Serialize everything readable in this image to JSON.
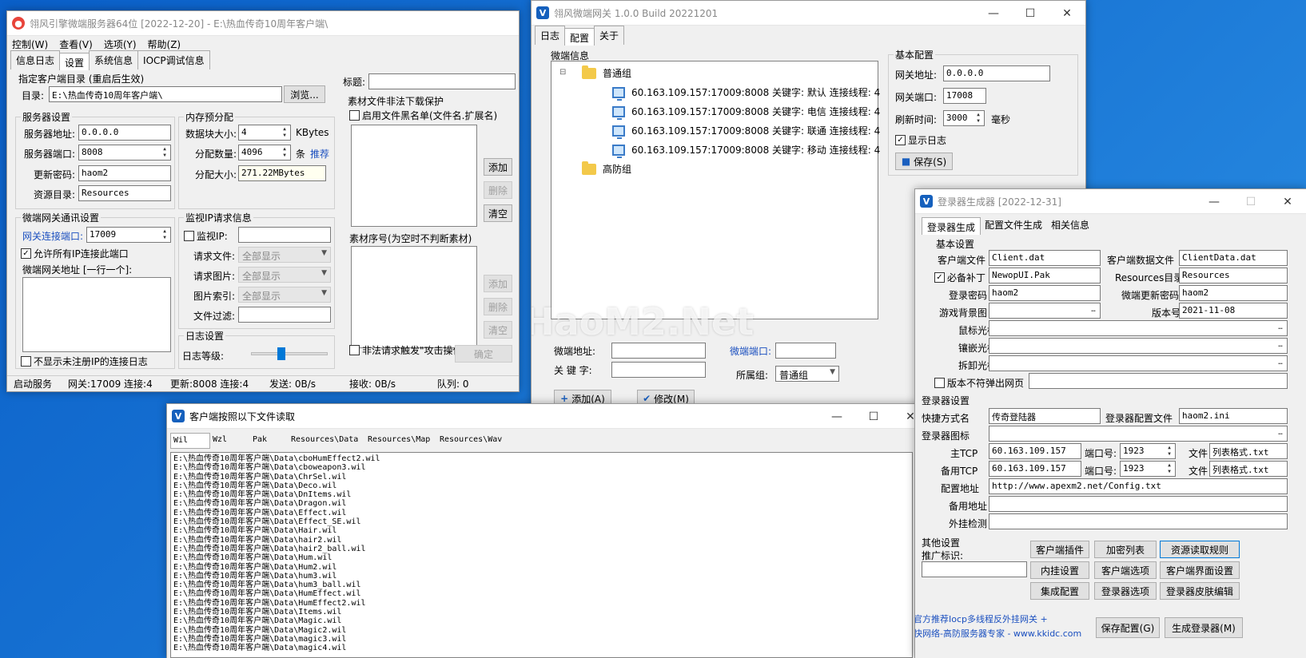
{
  "colors": {
    "accent": "#0078d7",
    "link": "#1a4fbf",
    "desktop": "#1b78d6",
    "gen_title_icon": "#1560bd"
  },
  "w1": {
    "title": "翎风引擎微端服务器64位 [2022-12-20] - E:\\热血传奇10周年客户端\\",
    "menu": [
      "控制(W)",
      "查看(V)",
      "选项(Y)",
      "帮助(Z)"
    ],
    "tabs": [
      "信息日志",
      "设置",
      "系统信息",
      "IOCP调试信息"
    ],
    "client_dir": {
      "title": "指定客户端目录 (重启后生效)",
      "label": "目录:",
      "value": "E:\\热血传奇10周年客户端\\",
      "browse": "浏览..."
    },
    "server": {
      "title": "服务器设置",
      "addr_label": "服务器地址:",
      "addr": "0.0.0.0",
      "port_label": "服务器端口:",
      "port": "8008",
      "pwd_label": "更新密码:",
      "pwd": "haom2",
      "res_label": "资源目录:",
      "res": "Resources"
    },
    "mem": {
      "title": "内存预分配",
      "block_label": "数据块大小:",
      "block": "4",
      "block_unit": "KBytes",
      "count_label": "分配数量:",
      "count": "4096",
      "count_unit": "条",
      "recommend": "推荐",
      "size_label": "分配大小:",
      "size": "271.22MBytes"
    },
    "gw": {
      "title": "微端网关通讯设置",
      "port_label": "网关连接端口:",
      "port": "17009",
      "allow": "允许所有IP连接此端口",
      "addr_label": "微端网关地址 [一行一个]:",
      "no_log": "不显示未注册IP的连接日志"
    },
    "monitor": {
      "title": "监视IP请求信息",
      "ip": "监视IP:",
      "req_file": "请求文件:",
      "req_img": "请求图片:",
      "img_idx": "图片索引:",
      "file_filter": "文件过滤:",
      "opt": "全部显示"
    },
    "log": {
      "title": "日志设置",
      "level_label": "日志等级:",
      "level": 0.4
    },
    "material": {
      "title_label": "标题:",
      "protect": "素材文件非法下载保护",
      "blacklist": "启用文件黑名单(文件名.扩展名)",
      "add": "添加",
      "del": "删除",
      "clear": "清空",
      "seq": "素材序号(为空时不判断素材)",
      "attack": "非法请求触发\"攻击操作\"",
      "ok": "确定"
    },
    "status": [
      "启动服务",
      "网关:17009  连接:4",
      "更新:8008  连接:4",
      "发送: 0B/s",
      "接收: 0B/s",
      "队列: 0"
    ]
  },
  "w2": {
    "title": "翎风微端网关 1.0.0 Build 20221201",
    "tabs": [
      "日志",
      "配置",
      "关于"
    ],
    "info_title": "微端信息",
    "group1": "普通组",
    "nodes": [
      "60.163.109.157:17009:8008 关键字: 默认 连接线程: 4",
      "60.163.109.157:17009:8008 关键字: 电信 连接线程: 4",
      "60.163.109.157:17009:8008 关键字: 联通 连接线程: 4",
      "60.163.109.157:17009:8008 关键字: 移动 连接线程: 4"
    ],
    "group2": "高防组",
    "micro_addr": "微端地址:",
    "micro_port": "微端端口:",
    "keyword": "关 键 字:",
    "group_label": "所属组:",
    "group_val": "普通组",
    "add": "添加(A)",
    "modify": "修改(M)",
    "basic": {
      "title": "基本配置",
      "addr_label": "网关地址:",
      "addr": "0.0.0.0",
      "port_label": "网关端口:",
      "port": "17008",
      "refresh_label": "刷新时间:",
      "refresh": "3000",
      "ms": "毫秒",
      "showlog": "显示日志",
      "save": "保存(S)"
    },
    "watermark": "HaoM2.Net"
  },
  "w3": {
    "title": "客户端按照以下文件读取",
    "cols": [
      "Wil",
      "Wzl",
      "Pak",
      "Resources\\Data",
      "Resources\\Map",
      "Resources\\Wav"
    ],
    "files": [
      "E:\\热血传奇10周年客户端\\Data\\cboHumEffect2.wil",
      "E:\\热血传奇10周年客户端\\Data\\cboweapon3.wil",
      "E:\\热血传奇10周年客户端\\Data\\ChrSel.wil",
      "E:\\热血传奇10周年客户端\\Data\\Deco.wil",
      "E:\\热血传奇10周年客户端\\Data\\DnItems.wil",
      "E:\\热血传奇10周年客户端\\Data\\Dragon.wil",
      "E:\\热血传奇10周年客户端\\Data\\Effect.wil",
      "E:\\热血传奇10周年客户端\\Data\\Effect_SE.wil",
      "E:\\热血传奇10周年客户端\\Data\\Hair.wil",
      "E:\\热血传奇10周年客户端\\Data\\hair2.wil",
      "E:\\热血传奇10周年客户端\\Data\\hair2_ball.wil",
      "E:\\热血传奇10周年客户端\\Data\\Hum.wil",
      "E:\\热血传奇10周年客户端\\Data\\Hum2.wil",
      "E:\\热血传奇10周年客户端\\Data\\hum3.wil",
      "E:\\热血传奇10周年客户端\\Data\\hum3_ball.wil",
      "E:\\热血传奇10周年客户端\\Data\\HumEffect.wil",
      "E:\\热血传奇10周年客户端\\Data\\HumEffect2.wil",
      "E:\\热血传奇10周年客户端\\Data\\Items.wil",
      "E:\\热血传奇10周年客户端\\Data\\Magic.wil",
      "E:\\热血传奇10周年客户端\\Data\\Magic2.wil",
      "E:\\热血传奇10周年客户端\\Data\\magic3.wil",
      "E:\\热血传奇10周年客户端\\Data\\magic4.wil"
    ]
  },
  "w4": {
    "title": "登录器生成器 [2022-12-31]",
    "tabs": [
      "登录器生成",
      "配置文件生成",
      "相关信息"
    ],
    "basic_title": "基本设置",
    "client_file_label": "客户端文件",
    "client_file": "Client.dat",
    "client_data_label": "客户端数据文件",
    "client_data": "ClientData.dat",
    "patch_label": "必备补丁",
    "patch": "NewopUI.Pak",
    "res_dir_label": "Resources目录",
    "res_dir": "Resources",
    "login_pwd_label": "登录密码",
    "login_pwd": "haom2",
    "micro_pwd_label": "微端更新密码",
    "micro_pwd": "haom2",
    "bg_label": "游戏背景图",
    "ver_label": "版本号",
    "ver": "2021-11-08",
    "cursor_label": "鼠标光标",
    "inlay_label": "镶嵌光标",
    "remove_label": "拆卸光标",
    "popup": "版本不符弹出网页",
    "login_title": "登录器设置",
    "shortcut_label": "快捷方式名",
    "shortcut": "传奇登陆器",
    "cfg_label": "登录器配置文件",
    "cfg": "haom2.ini",
    "icon_label": "登录器图标",
    "main_tcp_label": "主TCP",
    "main_tcp": "60.163.109.157",
    "port_label": "端口号:",
    "main_port": "1923",
    "file_label": "文件",
    "main_file": "列表格式.txt",
    "bak_tcp_label": "备用TCP",
    "bak_tcp": "60.163.109.157",
    "bak_port": "1923",
    "bak_file": "列表格式.txt",
    "cfg_addr_label": "配置地址",
    "cfg_addr": "http://www.apexm2.net/Config.txt",
    "bak_addr_label": "备用地址",
    "plugin_label": "外挂检测",
    "other_title": "其他设置",
    "promo_label": "推广标识:",
    "buttons": [
      "客户端插件",
      "加密列表",
      "资源读取规则",
      "内挂设置",
      "客户端选项",
      "客户端界面设置",
      "集成配置",
      "登录器选项",
      "登录器皮肤编辑"
    ],
    "promo1": "官方推荐Iocp多线程反外挂网关 +",
    "promo2": "快网络-高防服务器专家 - www.kkidc.com",
    "save": "保存配置(G)",
    "gen": "生成登录器(M)"
  }
}
